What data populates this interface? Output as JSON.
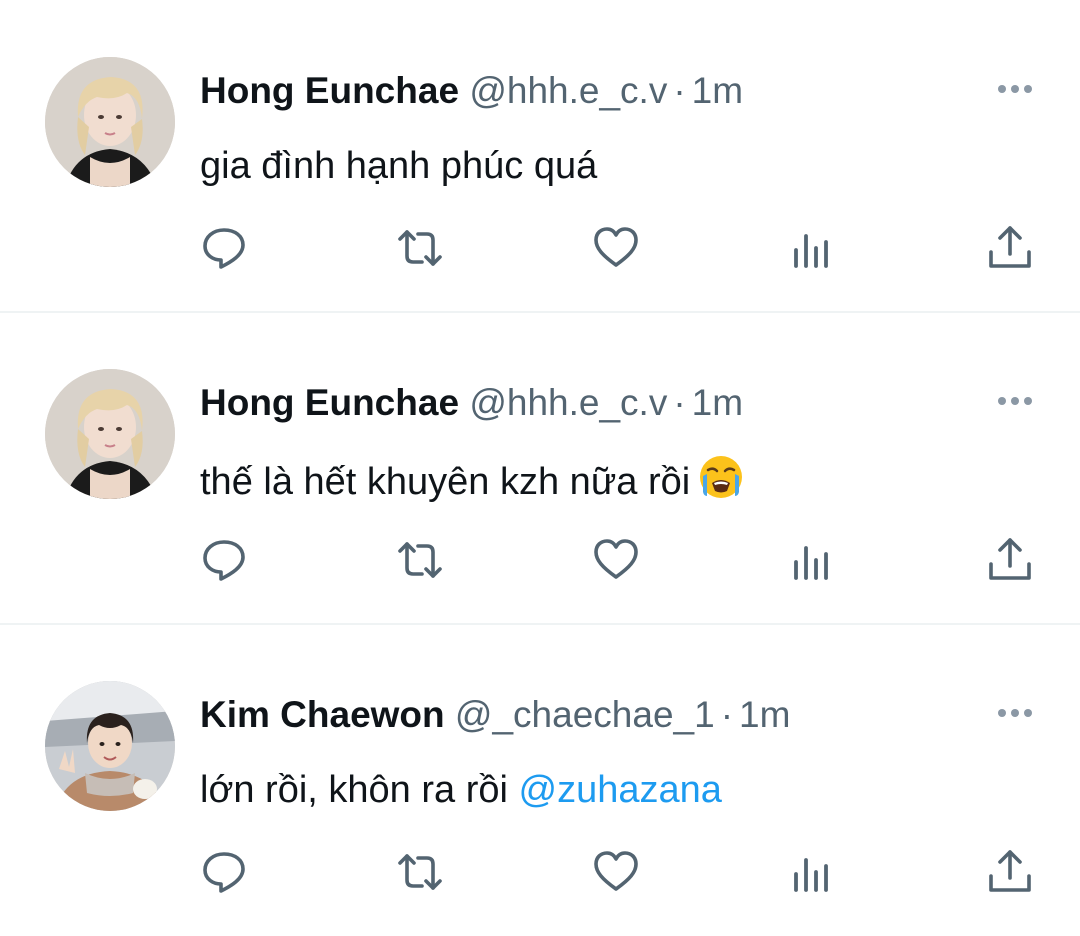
{
  "tweets": [
    {
      "name": "Hong Eunchae",
      "handle": "@hhh.e_c.v",
      "separator": "·",
      "time": "1m",
      "text": "gia đình hạnh phúc quá"
    },
    {
      "name": "Hong Eunchae",
      "handle": "@hhh.e_c.v",
      "separator": "·",
      "time": "1m",
      "text": "thế là hết khuyên kzh nữa rồi",
      "emoji": "loudly-crying-face"
    },
    {
      "name": "Kim Chaewon",
      "handle": "@_chaechae_1",
      "separator": "·",
      "time": "1m",
      "text": "lớn rồi, khôn ra rồi ",
      "mention": "@zuhazana"
    }
  ],
  "icons": {
    "more": "more-horizontal-icon",
    "reply": "reply-icon",
    "retweet": "retweet-icon",
    "like": "heart-icon",
    "views": "views-chart-icon",
    "share": "share-icon"
  },
  "colors": {
    "text": "#0f1419",
    "secondary": "#536471",
    "icon": "#536471",
    "link": "#1d9bf0",
    "divider": "#eff3f4"
  }
}
